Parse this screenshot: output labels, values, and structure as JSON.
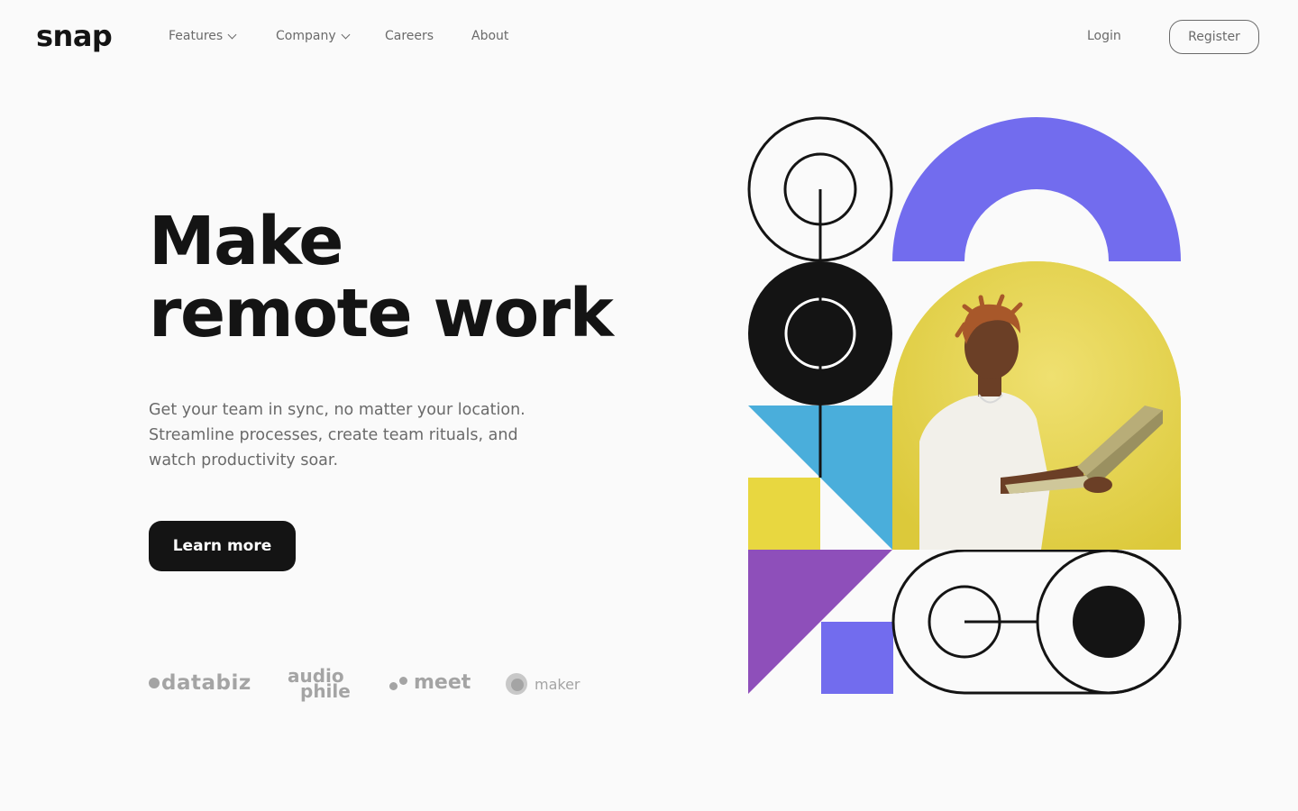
{
  "brand": {
    "logo": "snap"
  },
  "nav": {
    "items": [
      {
        "label": "Features",
        "dropdown": true
      },
      {
        "label": "Company",
        "dropdown": true
      },
      {
        "label": "Careers",
        "dropdown": false
      },
      {
        "label": "About",
        "dropdown": false
      }
    ],
    "login_label": "Login",
    "register_label": "Register"
  },
  "hero": {
    "headline_line1": "Make",
    "headline_line2": "remote work",
    "subtext": "Get your team in sync, no matter your location. Streamline processes, create team rituals, and watch productivity soar.",
    "cta_label": "Learn more"
  },
  "clients": [
    {
      "name": "databiz",
      "icon": "databiz-logo-icon"
    },
    {
      "name": "audiophile",
      "line1": "audio",
      "line2": "phile",
      "icon": "audiophile-logo-icon"
    },
    {
      "name": "meet",
      "icon": "meet-logo-icon"
    },
    {
      "name": "maker",
      "icon": "maker-logo-icon"
    }
  ],
  "colors": {
    "text_dark": "#141414",
    "text_grey": "#6a6a6a",
    "logo_grey": "#a4a4a4",
    "purple": "#726cee",
    "yellow": "#e8d740",
    "blue": "#4aaedb",
    "violet": "#8e4fba",
    "background": "#fafafa"
  }
}
